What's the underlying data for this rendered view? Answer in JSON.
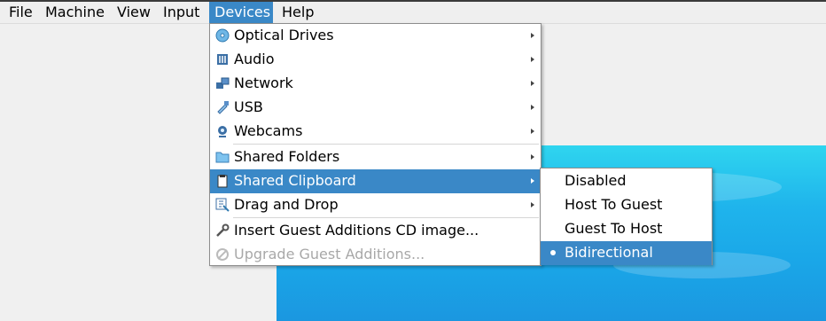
{
  "menubar": {
    "items": [
      "File",
      "Machine",
      "View",
      "Input",
      "Devices",
      "Help"
    ]
  },
  "devices_menu": {
    "items": [
      {
        "label": "Optical Drives",
        "icon": "optical-disc-icon",
        "submenu": true
      },
      {
        "label": "Audio",
        "icon": "audio-icon",
        "submenu": true
      },
      {
        "label": "Network",
        "icon": "network-icon",
        "submenu": true
      },
      {
        "label": "USB",
        "icon": "usb-icon",
        "submenu": true
      },
      {
        "label": "Webcams",
        "icon": "webcam-icon",
        "submenu": true
      },
      {
        "label": "Shared Folders",
        "icon": "folder-icon",
        "submenu": true
      },
      {
        "label": "Shared Clipboard",
        "icon": "clipboard-icon",
        "submenu": true,
        "highlighted": true
      },
      {
        "label": "Drag and Drop",
        "icon": "drag-drop-icon",
        "submenu": true
      },
      {
        "label": "Insert Guest Additions CD image...",
        "icon": "wrench-icon",
        "submenu": false
      },
      {
        "label": "Upgrade Guest Additions...",
        "icon": "upgrade-icon",
        "submenu": false,
        "disabled": true
      }
    ]
  },
  "clipboard_submenu": {
    "items": [
      "Disabled",
      "Host To Guest",
      "Guest To Host",
      "Bidirectional"
    ],
    "selected": "Bidirectional"
  },
  "colors": {
    "highlight": "#3a88c7",
    "guest_screen_top": "#2fd5ef",
    "guest_screen_bottom": "#1b97e0"
  }
}
